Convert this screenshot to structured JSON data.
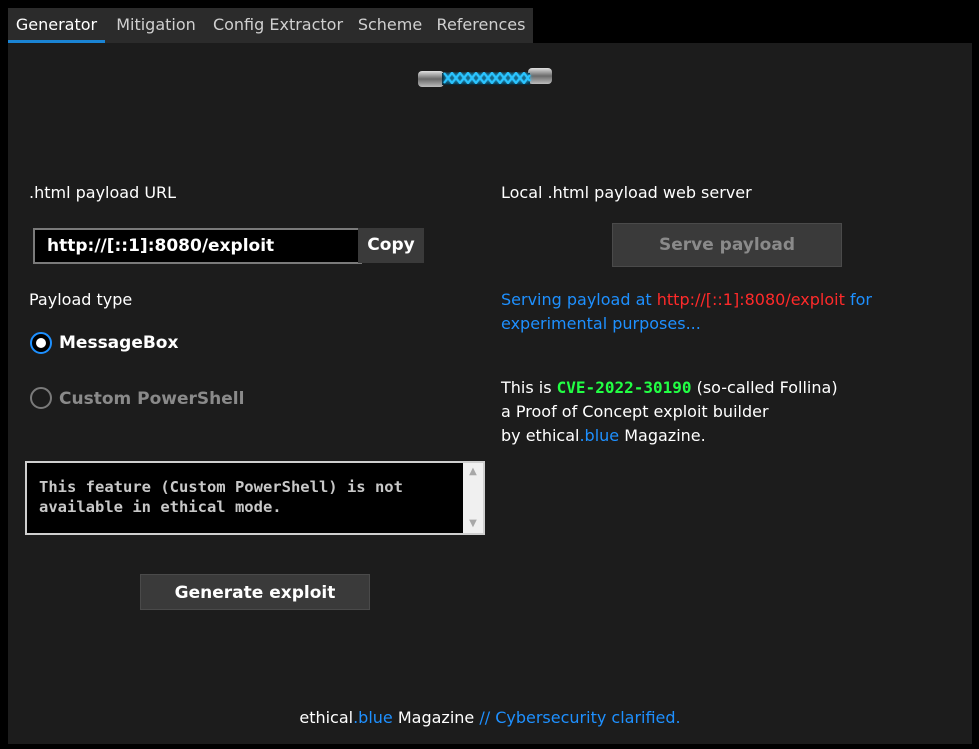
{
  "tabs": [
    {
      "label": "Generator",
      "active": true
    },
    {
      "label": "Mitigation"
    },
    {
      "label": "Config Extractor"
    },
    {
      "label": "Scheme"
    },
    {
      "label": "References"
    }
  ],
  "logo": {
    "icon": "glowing-coil-icon",
    "accent": "#29b6ff"
  },
  "left": {
    "url_label": ".html payload URL",
    "url_value": "http://[::1]:8080/exploit",
    "copy_label": "Copy",
    "payload_type_label": "Payload type",
    "radio_messagebox": "MessageBox",
    "radio_custom": "Custom PowerShell",
    "textbox_text": "This feature (Custom PowerShell) is not\navailable in ethical mode.",
    "generate_label": "Generate exploit"
  },
  "right": {
    "server_label": "Local .html payload web server",
    "serve_label": "Serve payload",
    "serving_prefix": "Serving payload at ",
    "serving_url": "http://[::1]:8080/exploit",
    "serving_suffix": " for",
    "serving_line2": "experimental purposes...",
    "about_prefix": "This is ",
    "about_cve": "CVE-2022-30190",
    "about_suffix": " (so-called Follina)",
    "about_line2": "a Proof of Concept exploit builder",
    "about_line3_prefix": "by ethical",
    "about_line3_blue": ".blue",
    "about_line3_suffix": " Magazine."
  },
  "footer": {
    "brand_a": "ethical",
    "brand_b": ".blue",
    "brand_c": " Magazine ",
    "sep": "//",
    "tag_a": " Cybersecurity",
    "tag_b": " clarified."
  },
  "colors": {
    "accent_blue": "#1e90ff",
    "url_red": "#ff2a2a",
    "cve_green": "#22ff44",
    "tab_underline": "#1a84d4"
  }
}
